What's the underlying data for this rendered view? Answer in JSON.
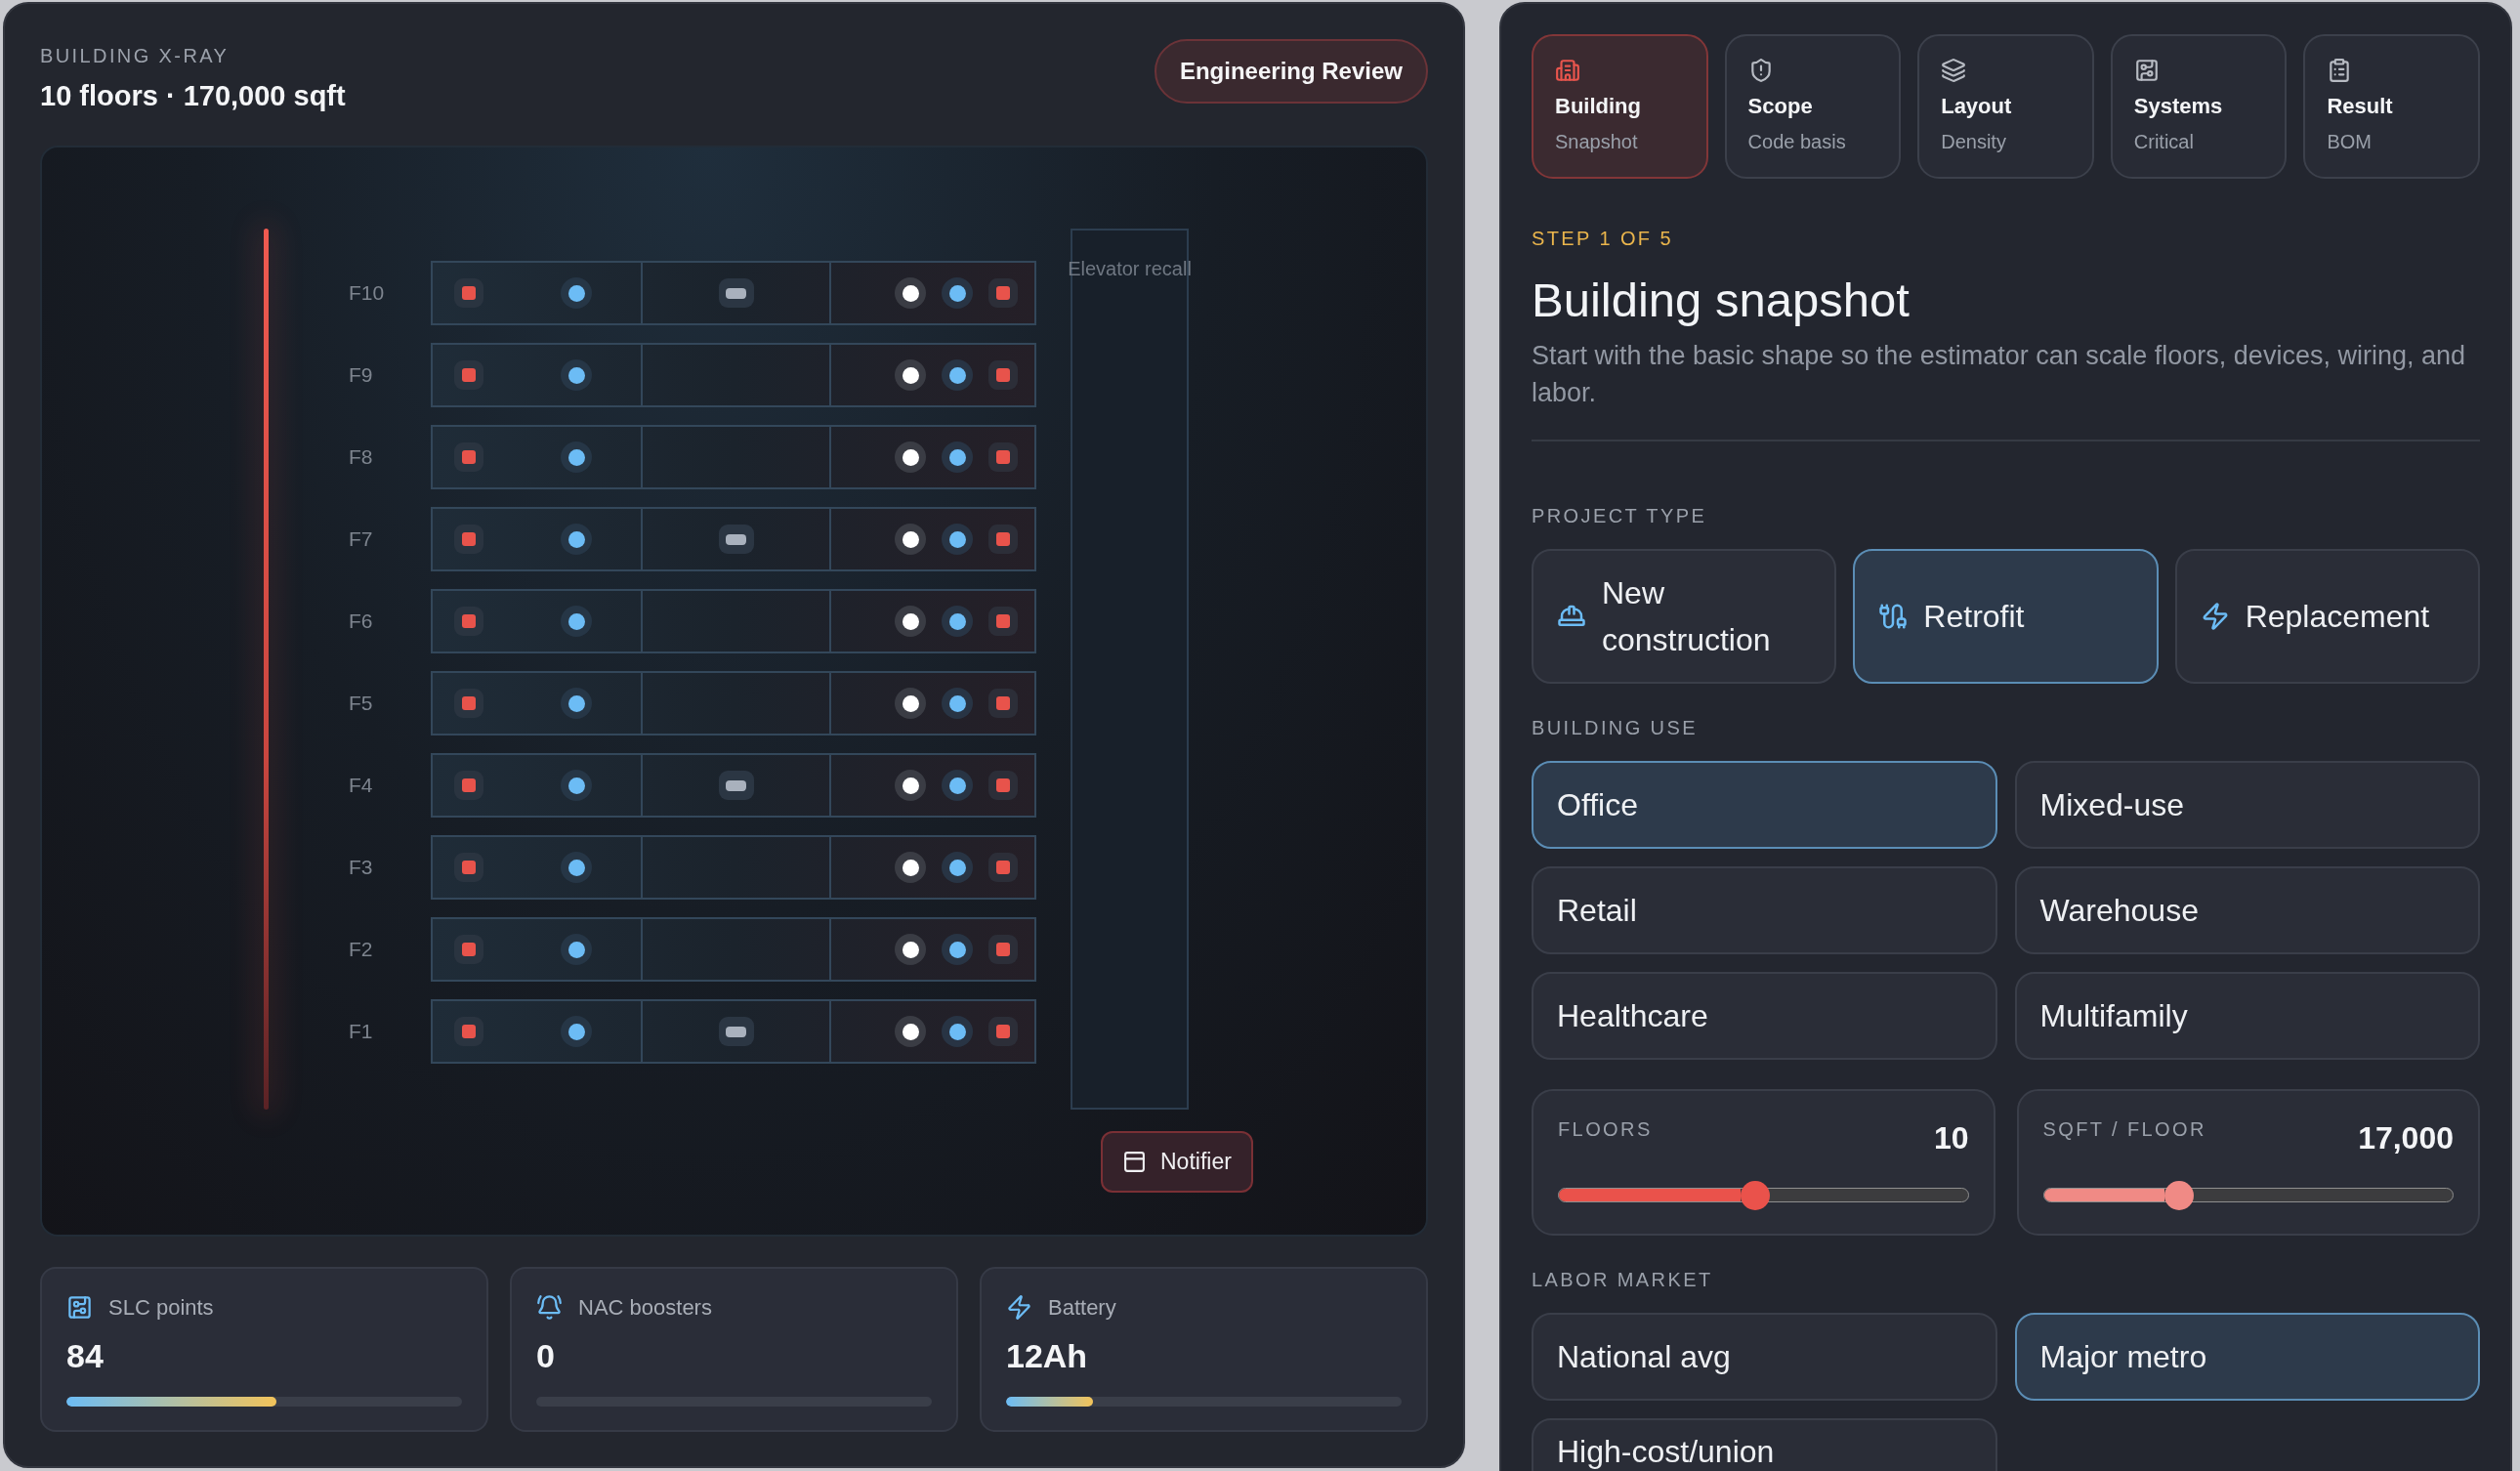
{
  "xray": {
    "eyebrow": "BUILDING X-RAY",
    "summary": "10 floors · 170,000 sqft",
    "review_button": "Engineering Review",
    "floors": [
      {
        "label": "F10",
        "center_device": true
      },
      {
        "label": "F9",
        "center_device": false
      },
      {
        "label": "F8",
        "center_device": false
      },
      {
        "label": "F7",
        "center_device": true
      },
      {
        "label": "F6",
        "center_device": false
      },
      {
        "label": "F5",
        "center_device": false
      },
      {
        "label": "F4",
        "center_device": true
      },
      {
        "label": "F3",
        "center_device": false
      },
      {
        "label": "F2",
        "center_device": false
      },
      {
        "label": "F1",
        "center_device": true
      }
    ],
    "shaft_label": "Elevator recall",
    "notifier_button": "Notifier"
  },
  "stats": [
    {
      "kind": "slc",
      "label": "SLC points",
      "value": "84",
      "level": 0.53
    },
    {
      "kind": "nac",
      "label": "NAC boosters",
      "value": "0",
      "level": 0
    },
    {
      "kind": "battery",
      "label": "Battery",
      "value": "12Ah",
      "level": 0.22
    }
  ],
  "steps": [
    {
      "kind": "building",
      "title": "Building",
      "subtitle": "Snapshot",
      "selected": true
    },
    {
      "kind": "scope",
      "title": "Scope",
      "subtitle": "Code basis",
      "selected": false
    },
    {
      "kind": "layout",
      "title": "Layout",
      "subtitle": "Density",
      "selected": false
    },
    {
      "kind": "systems",
      "title": "Systems",
      "subtitle": "Critical",
      "selected": false
    },
    {
      "kind": "result",
      "title": "Result",
      "subtitle": "BOM",
      "selected": false
    }
  ],
  "step_counter": "STEP 1 OF 5",
  "heading": "Building snapshot",
  "description": "Start with the basic shape so the estimator can scale floors, devices, wiring, and labor.",
  "project_type": {
    "label": "PROJECT TYPE",
    "options": [
      {
        "kind": "new",
        "label": "New construction",
        "selected": false
      },
      {
        "kind": "retrofit",
        "label": "Retrofit",
        "selected": true
      },
      {
        "kind": "replacement",
        "label": "Replacement",
        "selected": false
      }
    ]
  },
  "building_use": {
    "label": "BUILDING USE",
    "options": [
      {
        "label": "Office",
        "selected": true
      },
      {
        "label": "Mixed-use",
        "selected": false
      },
      {
        "label": "Retail",
        "selected": false
      },
      {
        "label": "Warehouse",
        "selected": false
      },
      {
        "label": "Healthcare",
        "selected": false
      },
      {
        "label": "Multifamily",
        "selected": false
      }
    ]
  },
  "sliders": [
    {
      "label": "FLOORS",
      "value": "10",
      "level": 0.48,
      "color": "#ea524b"
    },
    {
      "label": "SQFT / FLOOR",
      "value": "17,000",
      "level": 0.33,
      "color": "#f08a85"
    }
  ],
  "labor_market": {
    "label": "LABOR MARKET",
    "options": [
      {
        "label": "National avg",
        "selected": false
      },
      {
        "label": "Major metro",
        "selected": true
      },
      {
        "label": "High-cost/union",
        "selected": false
      }
    ]
  }
}
